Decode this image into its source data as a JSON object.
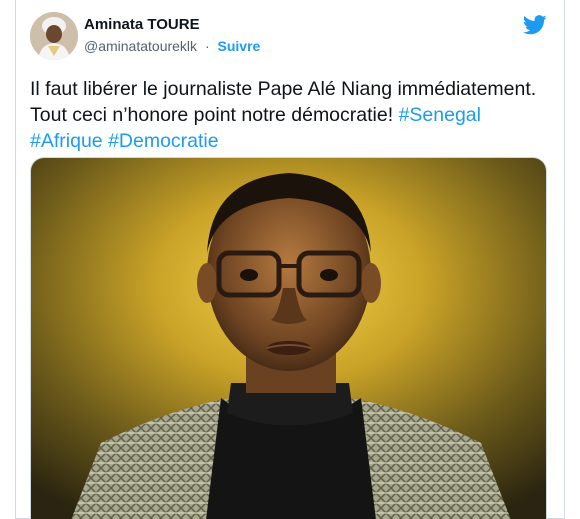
{
  "author": {
    "display_name": "Aminata TOURE",
    "handle": "@aminatatoureklk",
    "separator": "·",
    "follow_label": "Suivre"
  },
  "tweet": {
    "text_before": "Il faut libérer le journaliste Pape Alé Niang immédiatement. Tout ceci n’honore point notre démocratie! ",
    "hashtags": [
      "#Senegal",
      "#Afrique",
      "#Democratie"
    ]
  },
  "icons": {
    "brand": "twitter-bird-icon"
  },
  "colors": {
    "link": "#1d9bf0",
    "text": "#0f1419",
    "muted": "#536471"
  }
}
